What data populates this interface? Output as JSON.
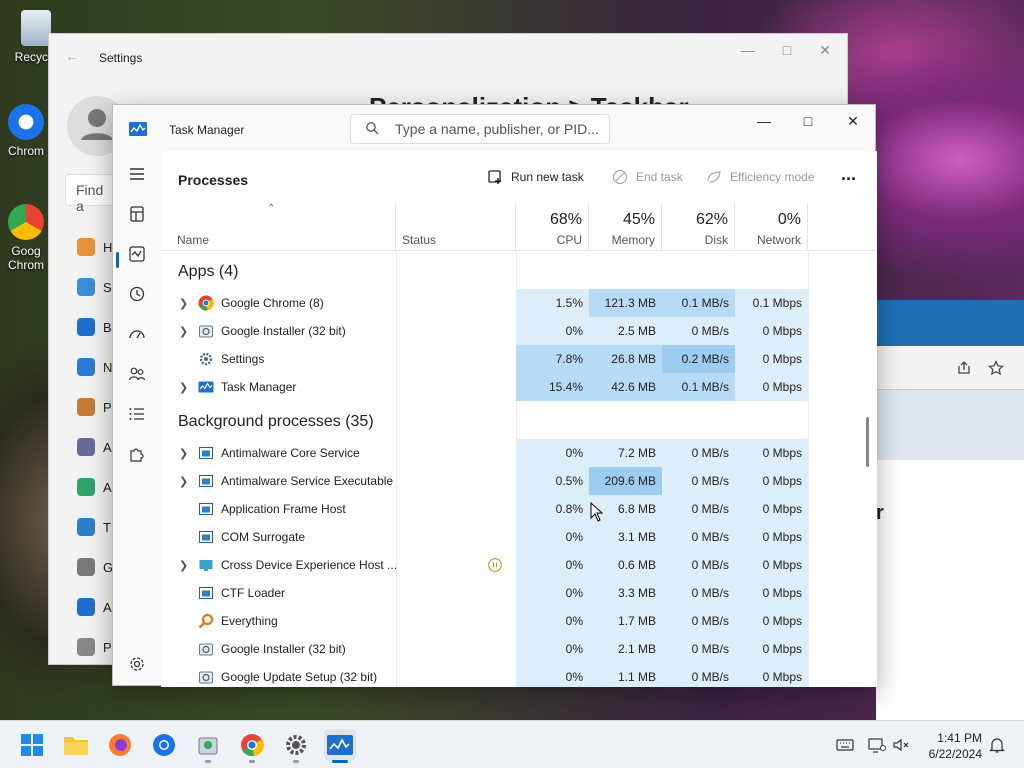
{
  "desktop": {
    "icons": [
      {
        "label": "Recycle",
        "icon": "recycle-bin-icon"
      },
      {
        "label": "Chrom",
        "icon": "chromium-icon"
      },
      {
        "label": "Goog Chrom",
        "icon": "google-chrome-icon"
      }
    ]
  },
  "settings": {
    "title": "Settings",
    "heading": "Personalization  >  Taskbar",
    "find_placeholder": "Find a",
    "nav_letters": [
      "H",
      "S",
      "B",
      "N",
      "P",
      "A",
      "A",
      "T",
      "G",
      "A",
      "P"
    ]
  },
  "task_manager": {
    "title": "Task Manager",
    "search_placeholder": "Type a name, publisher, or PID...",
    "page_title": "Processes",
    "toolbar": {
      "run_new_task": "Run new task",
      "end_task": "End task",
      "efficiency_mode": "Efficiency mode",
      "more": "..."
    },
    "columns": {
      "name": "Name",
      "status": "Status",
      "cpu_pct": "68%",
      "cpu": "CPU",
      "memory_pct": "45%",
      "memory": "Memory",
      "disk_pct": "62%",
      "disk": "Disk",
      "network_pct": "0%",
      "network": "Network"
    },
    "sections": {
      "apps": "Apps (4)",
      "background": "Background processes (35)"
    },
    "apps": [
      {
        "name": "Google Chrome (8)",
        "expand": true,
        "icon": "chrome-icon",
        "cpu": "1.5%",
        "memory": "121.3 MB",
        "disk": "0.1 MB/s",
        "network": "0.1 Mbps"
      },
      {
        "name": "Google Installer (32 bit)",
        "expand": true,
        "icon": "installer-icon",
        "cpu": "0%",
        "memory": "2.5 MB",
        "disk": "0 MB/s",
        "network": "0 Mbps"
      },
      {
        "name": "Settings",
        "expand": false,
        "icon": "gear-icon",
        "cpu": "7.8%",
        "memory": "26.8 MB",
        "disk": "0.2 MB/s",
        "network": "0 Mbps"
      },
      {
        "name": "Task Manager",
        "expand": true,
        "icon": "task-manager-icon",
        "cpu": "15.4%",
        "memory": "42.6 MB",
        "disk": "0.1 MB/s",
        "network": "0 Mbps"
      }
    ],
    "background": [
      {
        "name": "Antimalware Core Service",
        "expand": true,
        "icon": "service-icon",
        "cpu": "0%",
        "memory": "7.2 MB",
        "disk": "0 MB/s",
        "network": "0 Mbps"
      },
      {
        "name": "Antimalware Service Executable",
        "expand": true,
        "icon": "service-icon",
        "cpu": "0.5%",
        "memory": "209.6 MB",
        "disk": "0 MB/s",
        "network": "0 Mbps"
      },
      {
        "name": "Application Frame Host",
        "expand": false,
        "icon": "service-icon",
        "cpu": "0.8%",
        "memory": "6.8 MB",
        "disk": "0 MB/s",
        "network": "0 Mbps"
      },
      {
        "name": "COM Surrogate",
        "expand": false,
        "icon": "service-icon",
        "cpu": "0%",
        "memory": "3.1 MB",
        "disk": "0 MB/s",
        "network": "0 Mbps"
      },
      {
        "name": "Cross Device Experience Host ...",
        "expand": true,
        "icon": "cross-device-icon",
        "status": "paused",
        "cpu": "0%",
        "memory": "0.6 MB",
        "disk": "0 MB/s",
        "network": "0 Mbps"
      },
      {
        "name": "CTF Loader",
        "expand": false,
        "icon": "service-icon",
        "cpu": "0%",
        "memory": "3.3 MB",
        "disk": "0 MB/s",
        "network": "0 Mbps"
      },
      {
        "name": "Everything",
        "expand": false,
        "icon": "magnifier-icon",
        "cpu": "0%",
        "memory": "1.7 MB",
        "disk": "0 MB/s",
        "network": "0 Mbps"
      },
      {
        "name": "Google Installer (32 bit)",
        "expand": false,
        "icon": "installer-icon",
        "cpu": "0%",
        "memory": "2.1 MB",
        "disk": "0 MB/s",
        "network": "0 Mbps"
      },
      {
        "name": "Google Update Setup (32 bit)",
        "expand": false,
        "icon": "installer-icon",
        "cpu": "0%",
        "memory": "1.1 MB",
        "disk": "0 MB/s",
        "network": "0 Mbps"
      }
    ]
  },
  "taskbar": {
    "apps": [
      "start-icon",
      "file-explorer-icon",
      "firefox-icon",
      "chromium-icon",
      "installer-icon",
      "google-chrome-icon",
      "settings-gear-icon",
      "task-manager-icon"
    ],
    "time": "1:41 PM",
    "date": "6/22/2024"
  },
  "colors": {
    "accent": "#0067c0",
    "heat_low": "#ddeefb",
    "heat_mid": "#b8dbf5",
    "heat_high": "#9ccdf0"
  }
}
